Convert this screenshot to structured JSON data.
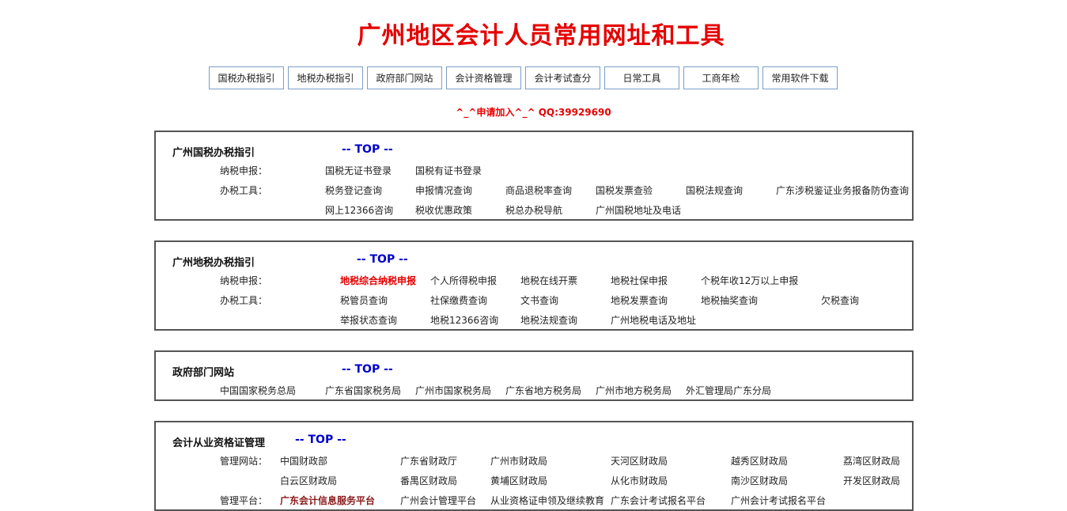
{
  "title": "广州地区会计人员常用网址和工具",
  "nav": [
    "国税办税指引",
    "地税办税指引",
    "政府部门网站",
    "会计资格管理",
    "会计考试查分",
    "日常工具",
    "工商年检",
    "常用软件下载"
  ],
  "qq_line": "^_^申请加入^_^ QQ:39929690",
  "top_label": "-- TOP --",
  "guoshui": {
    "title": "广州国税办税指引",
    "row1_label": "纳税申报：",
    "row1": [
      "国税无证书登录",
      "国税有证书登录"
    ],
    "row2_label": "办税工具：",
    "row2": [
      "税务登记查询",
      "申报情况查询",
      "商品退税率查询",
      "国税发票查验",
      "国税法规查询",
      "广东涉税鉴证业务报备防伪查询"
    ],
    "row3": [
      "网上12366咨询",
      "税收优惠政策",
      "税总办税导航",
      "广州国税地址及电话"
    ]
  },
  "dishui": {
    "title": "广州地税办税指引",
    "row1_label": "纳税申报：",
    "row1": [
      "地税综合纳税申报",
      "个人所得税申报",
      "地税在线开票",
      "地税社保申报",
      "个税年收12万以上申报"
    ],
    "row2_label": "办税工具：",
    "row2": [
      "税管员查询",
      "社保缴费查询",
      "文书查询",
      "地税发票查询",
      "地税抽奖查询",
      "欠税查询"
    ],
    "row3": [
      "举报状态查询",
      "地税12366咨询",
      "地税法规查询",
      "广州地税电话及地址"
    ]
  },
  "gov": {
    "title": "政府部门网站",
    "row1": [
      "中国国家税务总局",
      "广东省国家税务局",
      "广州市国家税务局",
      "广东省地方税务局",
      "广州市地方税务局",
      "外汇管理局广东分局"
    ]
  },
  "kuaiji": {
    "title": "会计从业资格证管理",
    "row1_label": "管理网站：",
    "row1": [
      "中国财政部",
      "广东省财政厅",
      "广州市财政局",
      "天河区财政局",
      "越秀区财政局",
      "荔湾区财政局"
    ],
    "row2": [
      "白云区财政局",
      "番禺区财政局",
      "黄埔区财政局",
      "从化市财政局",
      "南沙区财政局",
      "开发区财政局"
    ],
    "row3_label": "管理平台：",
    "row3": [
      "广东会计信息服务平台",
      "广州会计管理平台",
      "从业资格证申领及继续教育",
      "广东会计考试报名平台",
      "广州会计考试报名平台"
    ]
  }
}
